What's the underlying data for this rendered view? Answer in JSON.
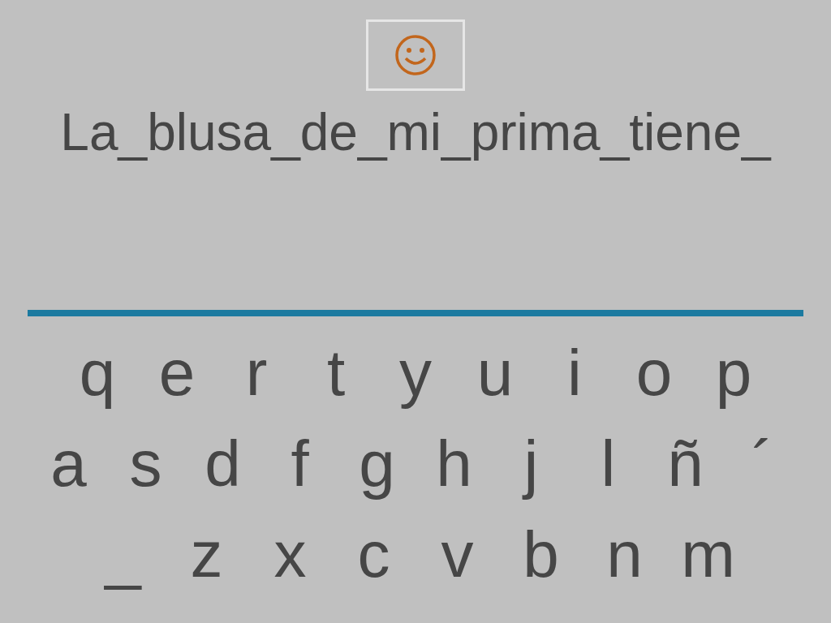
{
  "sentence": "La_blusa_de_mi_prima_tiene_",
  "keyboard": [
    {
      "keys": [
        "q",
        "e",
        "r",
        "t",
        "y",
        "u",
        "i",
        "o",
        "p"
      ]
    },
    {
      "keys": [
        "a",
        "s",
        "d",
        "f",
        "g",
        "h",
        "j",
        "l",
        "ñ",
        "´"
      ]
    },
    {
      "keys": [
        "_",
        "z",
        "x",
        "c",
        "v",
        "b",
        "n",
        "m"
      ]
    }
  ]
}
